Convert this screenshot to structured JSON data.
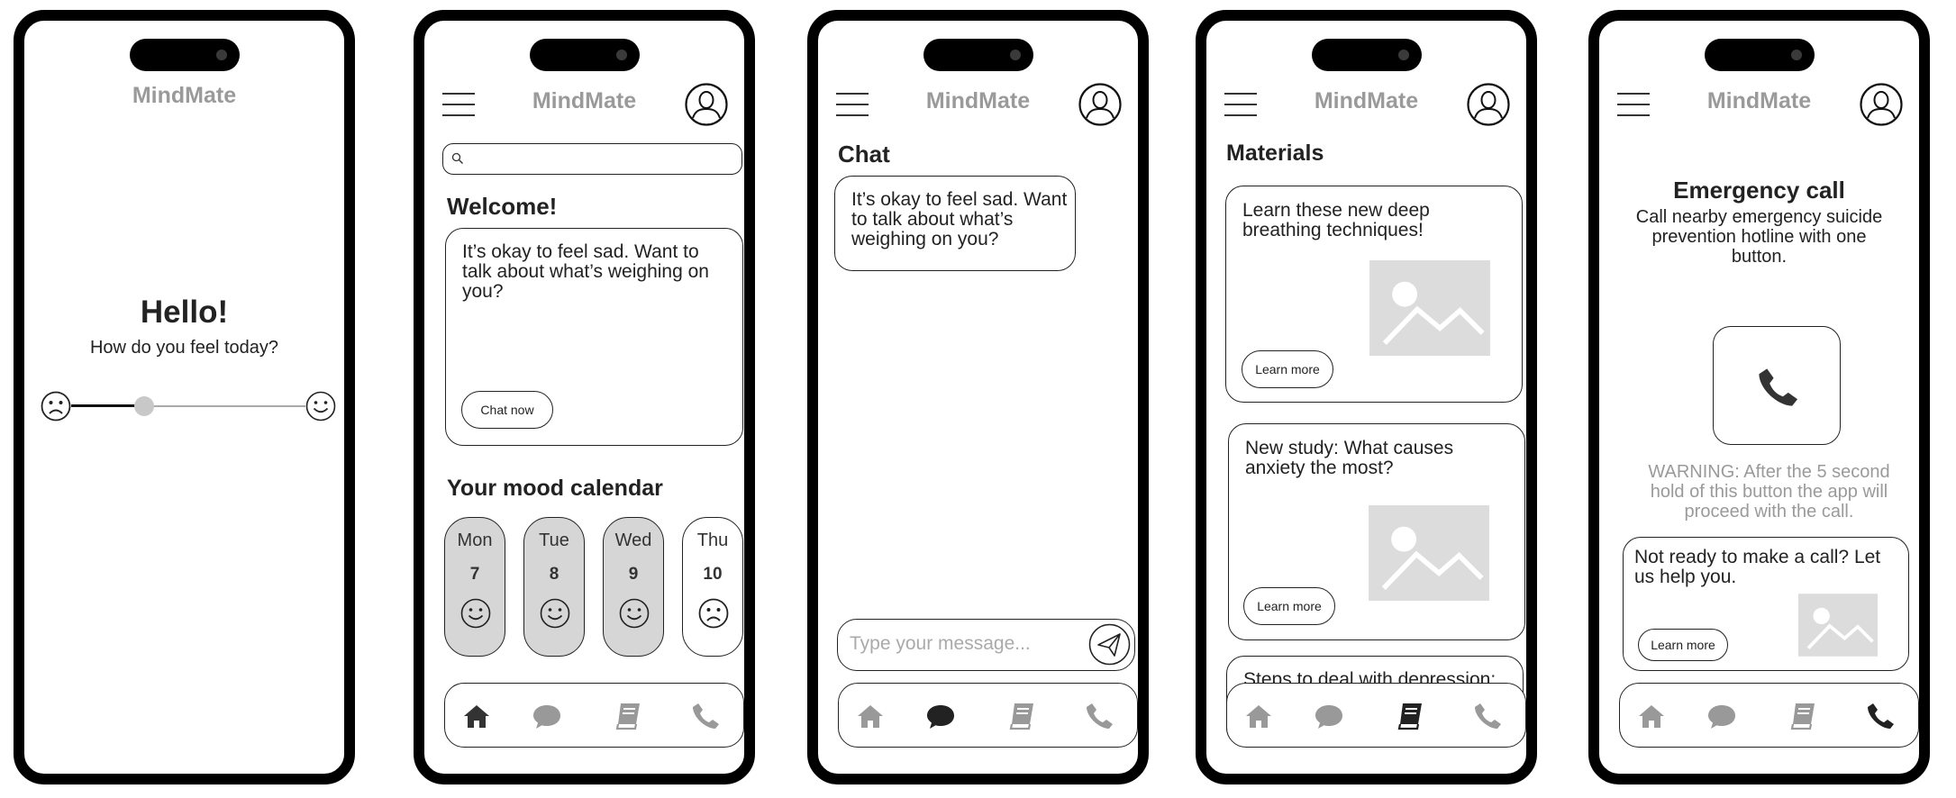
{
  "brand": "MindMate",
  "colors": {
    "frame": "#000000",
    "muted": "#9a9a9a",
    "card_fill": "#d6d6d6",
    "image_placeholder": "#dcdcdc"
  },
  "onboarding": {
    "title": "Hello!",
    "subtitle": "How do you feel today?",
    "mood_slider": {
      "value": 0.33,
      "left_icon": "sad-face-icon",
      "right_icon": "happy-face-icon"
    }
  },
  "home": {
    "search": {
      "placeholder": "",
      "icon": "search-icon"
    },
    "welcome_title": "Welcome!",
    "welcome_message": "It’s okay to feel sad. Want to talk about what’s weighing on you?",
    "chat_button": "Chat now",
    "calendar_title": "Your mood calendar",
    "days": [
      {
        "name": "Mon",
        "date": "7",
        "mood": "happy-face-icon",
        "filled": true
      },
      {
        "name": "Tue",
        "date": "8",
        "mood": "happy-face-icon",
        "filled": true
      },
      {
        "name": "Wed",
        "date": "9",
        "mood": "happy-face-icon",
        "filled": true
      },
      {
        "name": "Thu",
        "date": "10",
        "mood": "sad-face-icon",
        "filled": false
      }
    ]
  },
  "chat": {
    "title": "Chat",
    "bot_message": "It’s okay to feel sad. Want to talk about what’s weighing on you?",
    "input_placeholder": "Type your message...",
    "send_icon": "send-icon"
  },
  "materials": {
    "title": "Materials",
    "items": [
      {
        "text": "Learn these new deep breathing techniques!",
        "button": "Learn more"
      },
      {
        "text": "New study: What causes anxiety the most?",
        "button": "Learn more"
      },
      {
        "text": "Steps to deal with depression:",
        "button": ""
      }
    ]
  },
  "emergency": {
    "title": "Emergency call",
    "description": "Call nearby emergency suicide prevention hotline with one button.",
    "call_icon": "phone-icon",
    "warning": "WARNING: After the 5 second hold of this button the app will proceed with the call.",
    "help_text": "Not ready to make a call? Let us help you.",
    "help_button": "Learn more"
  },
  "nav": {
    "items": [
      {
        "icon": "home-icon",
        "label": "Home"
      },
      {
        "icon": "chat-icon",
        "label": "Chat"
      },
      {
        "icon": "book-icon",
        "label": "Materials"
      },
      {
        "icon": "phone-icon",
        "label": "Emergency"
      }
    ],
    "active_by_screen": {
      "home": "home-icon",
      "chat": "chat-icon",
      "materials": "book-icon",
      "emergency": "phone-icon"
    }
  }
}
